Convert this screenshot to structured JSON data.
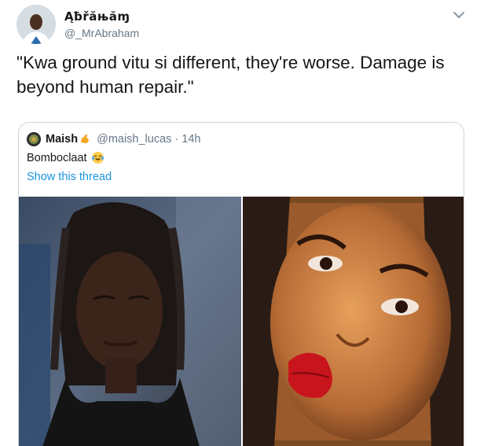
{
  "tweet": {
    "display_name": "Ąƀřăњăɱ",
    "handle": "@_MrAbraham",
    "text": "\"Kwa ground vitu si different, they're worse. Damage is beyond human repair.\"",
    "menu_icon": "chevron-down-icon"
  },
  "quote": {
    "name": "Maish",
    "name_emoji": "flexed-biceps-icon",
    "handle": "@maish_lucas",
    "separator": "·",
    "time": "14h",
    "text": "Bomboclaat",
    "text_emoji": "tears-of-joy-icon",
    "show_thread": "Show this thread",
    "photos": [
      "photo-left",
      "photo-right"
    ]
  },
  "colors": {
    "link": "#1b95e0",
    "secondary_text": "#657786",
    "border": "#ccd6dd"
  }
}
